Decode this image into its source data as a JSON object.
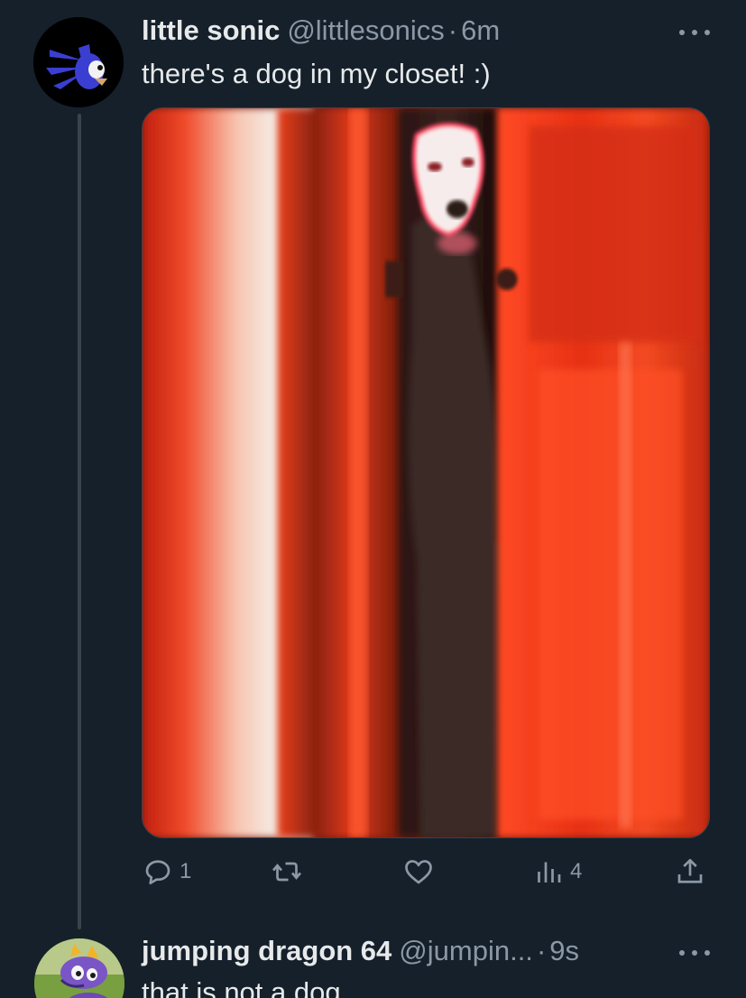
{
  "tweet": {
    "author_name": "little sonic",
    "author_handle": "@littlesonics",
    "separator": "·",
    "time": "6m",
    "text": "there's a dog in my closet! :)",
    "media_description_icon": "photo",
    "actions": {
      "reply_count": "1",
      "retweet_count": "",
      "like_count": "",
      "views_count": "4"
    }
  },
  "reply": {
    "author_name": "jumping dragon 64",
    "author_handle": "@jumpin...",
    "separator": "·",
    "time": "9s",
    "text": "that is not a dog"
  },
  "colors": {
    "background": "#15202b",
    "text_primary": "#e7e9ea",
    "text_secondary": "#8b98a5",
    "thread_line": "#38444d"
  }
}
